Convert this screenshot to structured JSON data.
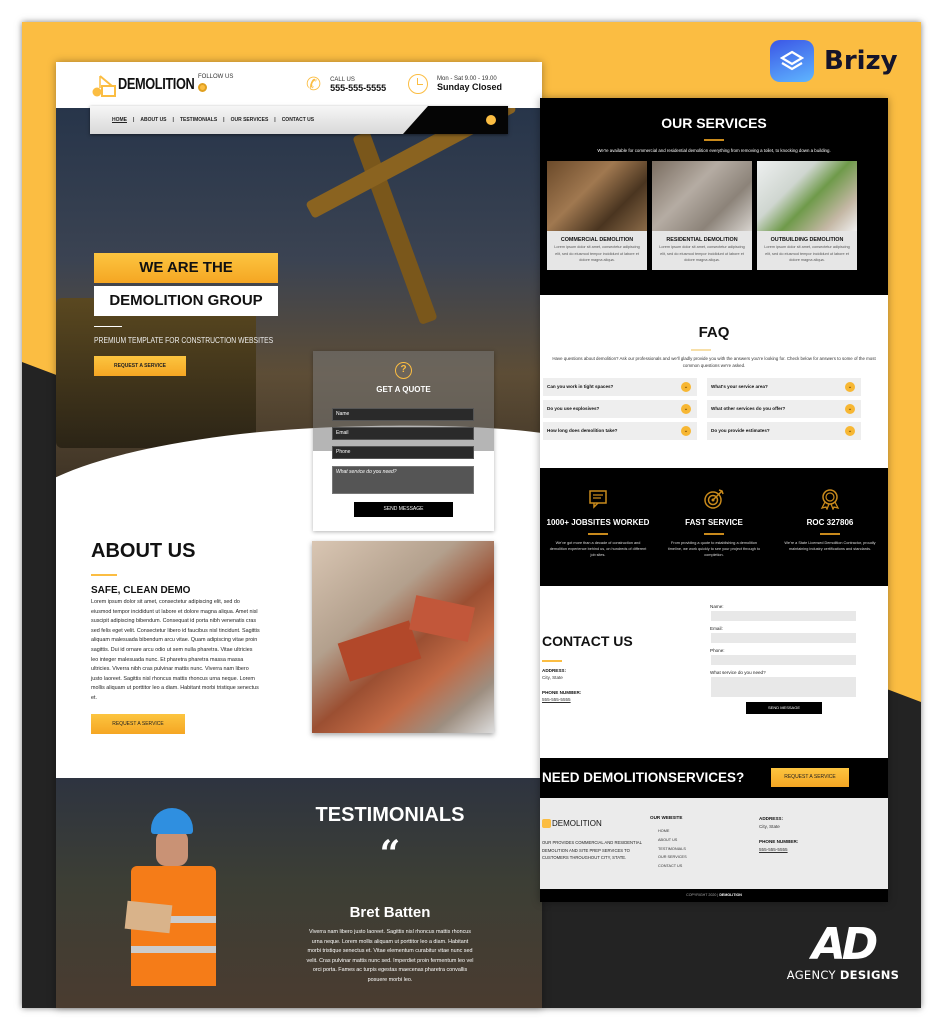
{
  "branding": {
    "builder_name": "Brizy",
    "agency_name_light": "AGENCY",
    "agency_name_bold": "DESIGNS",
    "agency_mark": "AD"
  },
  "colors": {
    "accent": "#fbbd42",
    "accent_dark": "#f5a623",
    "dark": "#232323",
    "black": "#000000",
    "light_gray": "#ebebeb"
  },
  "header": {
    "logo_text": "DEMOLITION",
    "follow_label": "FOLLOW US",
    "call_label": "CALL US",
    "phone": "555-555-5555",
    "hours_label": "Mon - Sat 9.00 - 19.00",
    "hours_closed": "Sunday Closed",
    "nav": [
      {
        "label": "HOME",
        "active": true
      },
      {
        "label": "ABOUT US",
        "active": false
      },
      {
        "label": "TESTIMONIALS",
        "active": false
      },
      {
        "label": "OUR SERVICES",
        "active": false
      },
      {
        "label": "CONTACT US",
        "active": false
      }
    ],
    "nav_separator": "|"
  },
  "hero": {
    "title_line1": "WE ARE THE",
    "title_line2": "DEMOLITION GROUP",
    "subtitle": "PREMIUM TEMPLATE FOR CONSTRUCTION WEBSITES",
    "cta_label": "REQUEST A SERVICE"
  },
  "quote_form": {
    "title": "GET A QUOTE",
    "icon": "question-bubble-icon",
    "name_placeholder": "Name",
    "email_placeholder": "Email",
    "phone_placeholder": "Phone",
    "service_placeholder": "What service do you need?",
    "submit_label": "SEND MESSAGE"
  },
  "about": {
    "title": "ABOUT US",
    "subtitle": "SAFE, CLEAN DEMO",
    "body": "Lorem ipsum dolor sit amet, consectetur adipiscing elit, sed do eiusmod tempor incididunt ut labore et dolore magna aliqua. Amet nisl suscipit adipiscing bibendum. Consequat id porta nibh venenatis cras sed felis eget velit. Consectetur libero id faucibus nisl tincidunt. Sagittis aliquam malesuada bibendum arcu vitae. Quam adipiscing vitae proin sagittis. Dui id ornare arcu odio ut sem nulla pharetra. Vitae ultricies leo integer malesuada nunc. Et pharetra pharetra massa massa ultricies. Viverra nibh cras pulvinar mattis nunc. Viverra nam libero justo laoreet. Sagittis nisl rhoncus mattis rhoncus urna neque. Lorem mollis aliquam ut porttitor leo a diam. Habitant morbi tristique senectus et.",
    "cta_label": "REQUEST A SERVICE"
  },
  "testimonials": {
    "title": "TESTIMONIALS",
    "quote_mark": "“",
    "name": "Bret Batten",
    "text": "Viverra nam libero justo laoreet. Sagittis nisl rhoncus mattis rhoncus urna neque. Lorem mollis aliquam ut porttitor leo a diam. Habitant morbi tristique senectus et. Vitae elementum curabitur vitae nunc sed velit. Cras pulvinar mattis nunc sed. Imperdiet proin fermentum leo vel orci porta. Fames ac turpis egestas maecenas pharetra convallis posuere morbi leo."
  },
  "services": {
    "title": "OUR SERVICES",
    "description": "We're available for commercial and residential demolition everything from removing a toilet, to knocking down a building.",
    "cards": [
      {
        "title": "COMMERCIAL DEMOLITION",
        "text": "Lorem ipsum dolor sit amet, consectetur adipiscing elit, sed do eiusmod tempor incididunt ut labore et dolore magna aliqua."
      },
      {
        "title": "RESIDENTIAL DEMOLITION",
        "text": "Lorem ipsum dolor sit amet, consectetur adipiscing elit, sed do eiusmod tempor incididunt ut labore et dolore magna aliqua."
      },
      {
        "title": "OUTBUILDING DEMOLITION",
        "text": "Lorem ipsum dolor sit amet, consectetur adipiscing elit, sed do eiusmod tempor incididunt ut labore et dolore magna aliqua."
      }
    ]
  },
  "faq": {
    "title": "FAQ",
    "description": "Have questions about demolition? Ask our professionals and we'll gladly provide you with the answers you're looking for. Check below for answers to some of the most common questions we're asked.",
    "questions": [
      "Can you work in tight spaces?",
      "What's your service area?",
      "Do you use explosives?",
      "What other services do you offer?",
      "How long does demolition take?",
      "Do you provide estimates?"
    ]
  },
  "stats": [
    {
      "icon": "chat-icon",
      "title": "1000+ JOBSITES WORKED",
      "text": "We've got more than a decade of construction and demolition experience behind us, on hundreds of different job sites."
    },
    {
      "icon": "target-icon",
      "title": "FAST SERVICE",
      "text": "From providing a quote to establishing a demolition timeline, we work quickly to see your project through to completion."
    },
    {
      "icon": "award-icon",
      "title": "ROC 327806",
      "text": "We're a State Licensed Demolition Contractor, proudly maintaining industry certifications and standards."
    }
  ],
  "contact": {
    "title": "CONTACT US",
    "address_label": "ADDRESS:",
    "address_value": "City, State",
    "phone_label": "PHONE NUMBER:",
    "phone_value": "555-555-5555",
    "form": {
      "name_label": "Name:",
      "email_label": "Email:",
      "phone_label": "Phone:",
      "service_label": "What service do you need?",
      "submit_label": "SEND MESSAGE"
    }
  },
  "cta": {
    "title": "NEED DEMOLITIONSERVICES?",
    "button_label": "REQUEST A SERVICE"
  },
  "footer": {
    "logo_text": "DEMOLITION",
    "about": "OUR PROVIDES COMMERCIAL AND RESIDENTIAL DEMOLITION AND SITE PREP SERVICES TO CUSTOMERS THROUGHOUT CITY, STATE.",
    "website_heading": "OUR WEBSITE",
    "links": [
      "HOME",
      "ABOUT US",
      "TESTIMONIALS",
      "OUR SERVICES",
      "CONTACT US"
    ],
    "address_label": "ADDRESS:",
    "address_value": "City, State",
    "phone_label": "PHONE NUMBER:",
    "phone_value": "555-555-5555",
    "copyright_prefix": "COPYRIGHT 2020 |",
    "copyright_brand": "DEMOLITION"
  }
}
